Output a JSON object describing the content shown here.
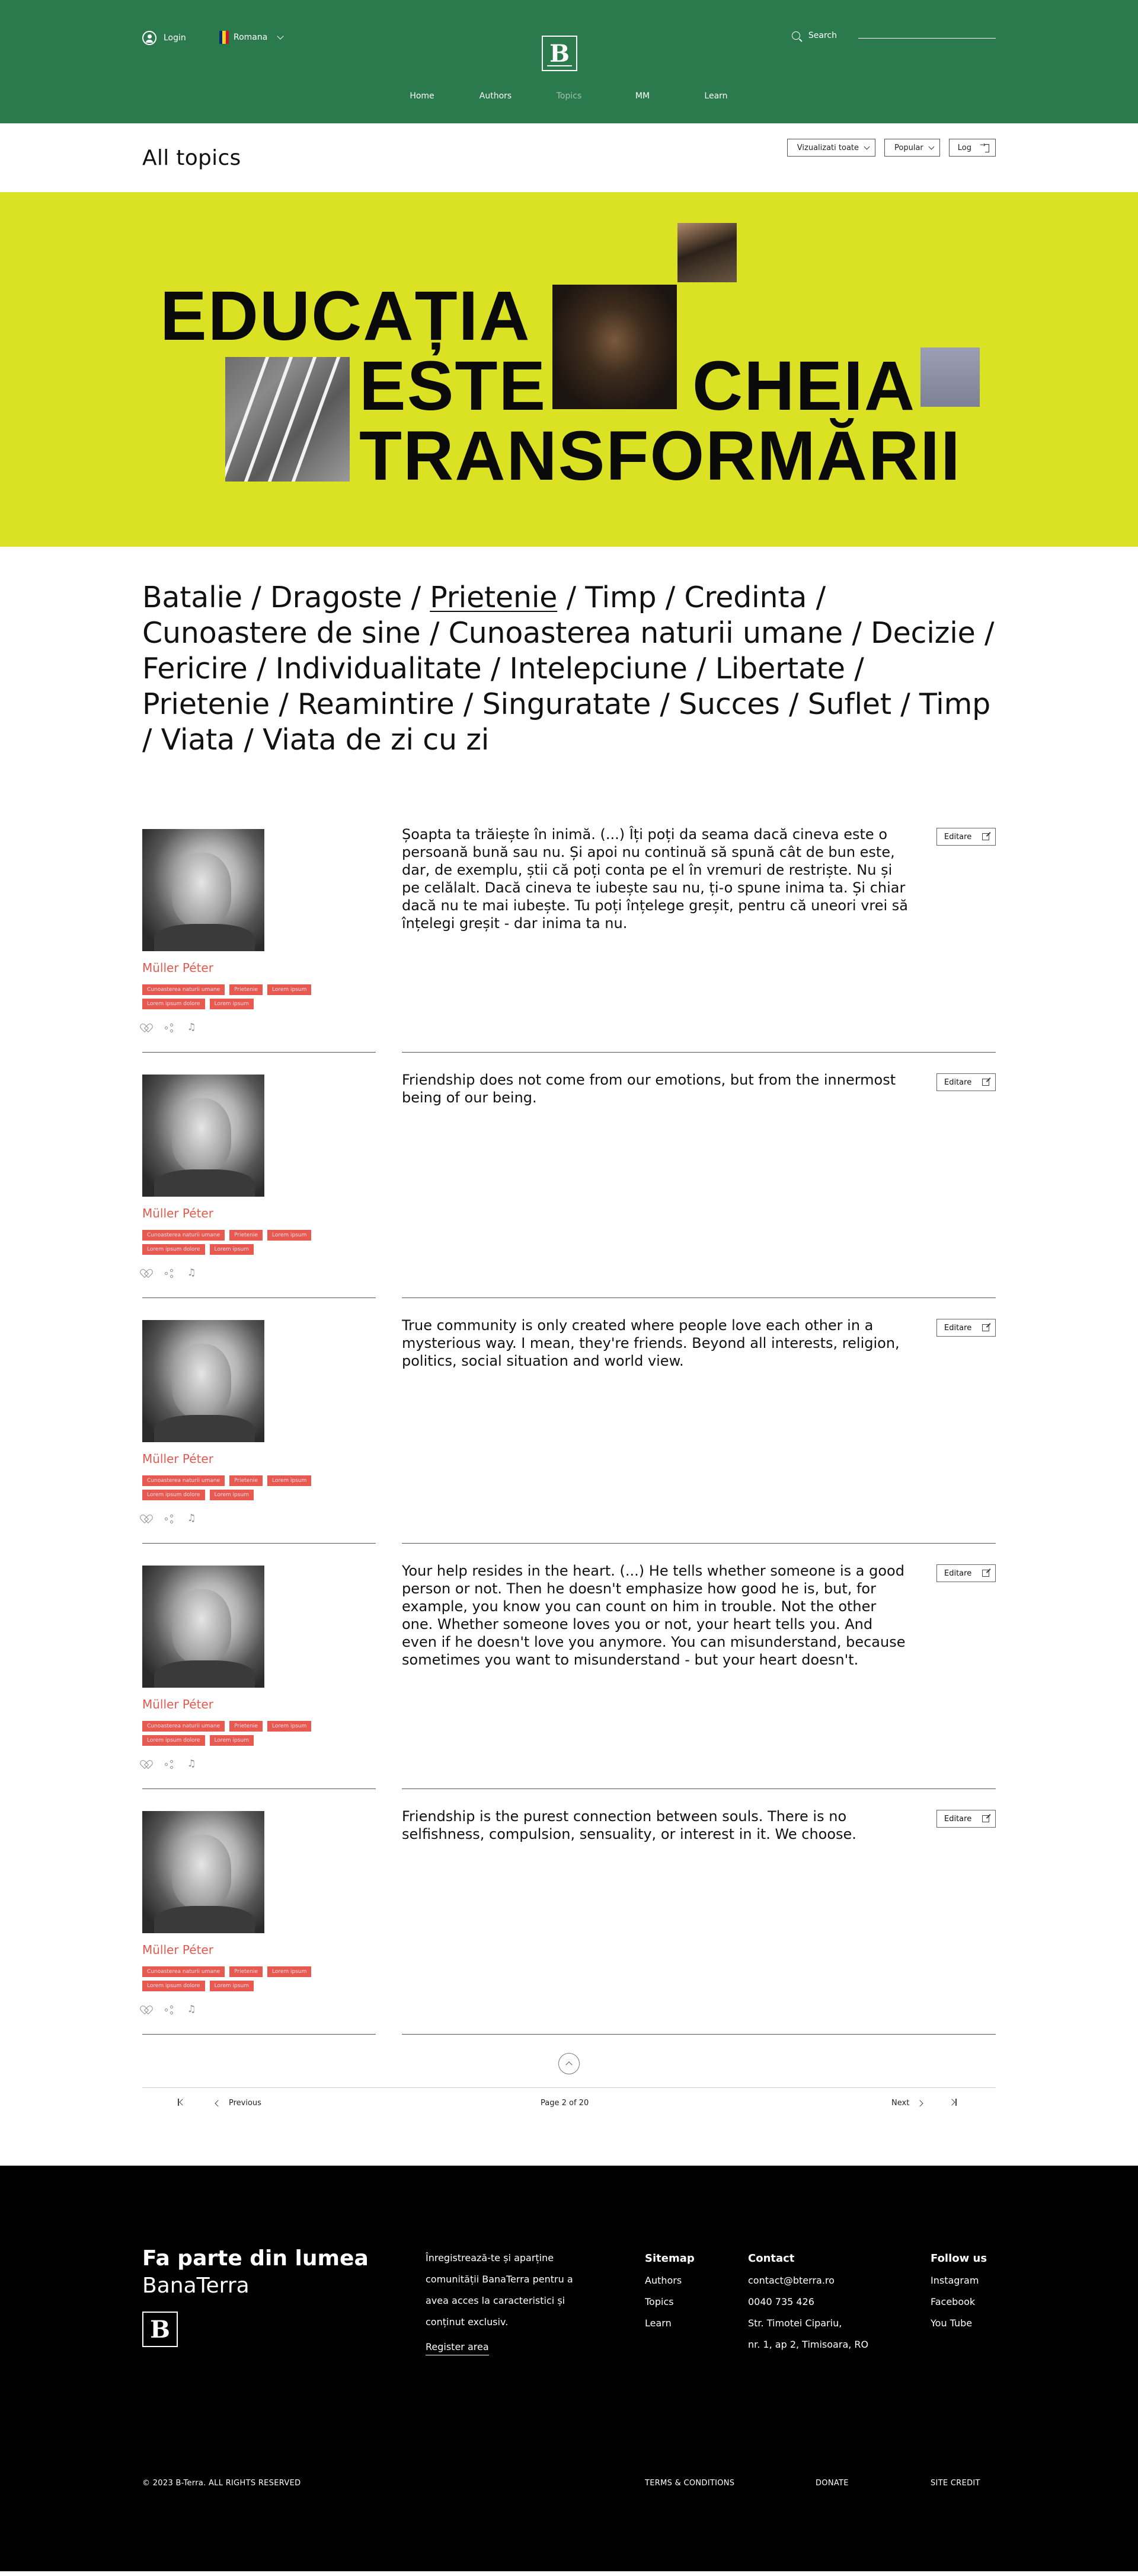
{
  "header": {
    "login_label": "Login",
    "language_label": "Romana",
    "logo_letter": "B",
    "search_label": "Search",
    "nav": [
      "Home",
      "Authors",
      "Topics",
      "MM",
      "Learn"
    ],
    "active_nav": "Topics",
    "flag_colors": [
      "#002b7f",
      "#fcd116",
      "#ce1126"
    ]
  },
  "toolbar": {
    "title": "All topics",
    "view_select": "Vizualizati toate",
    "sort_select": "Popular",
    "log_label": "Log"
  },
  "hero": {
    "line1": "EDUCAȚIA",
    "line2a": "ESTE",
    "line2b": "CHEIA",
    "line3": "TRANSFORMĂRII",
    "background": "#dbe123"
  },
  "topics": {
    "before": "Batalie / Dragoste / ",
    "selected": "Prietenie",
    "after": " / Timp / Credinta / Cunoastere de sine / Cunoasterea naturii umane / Decizie / Fericire / Individualitate / Intelepciune / Libertate / Prietenie / Reamintire / Singuratate / Succes / Suflet /  Timp / Viata / Viata de zi cu zi"
  },
  "quote_common": {
    "author": "Müller Péter",
    "tags": [
      "Cunoasterea naturii umane",
      "Prietenie",
      "Lorem ipsum",
      "Lorem ipsum dolore",
      "Lorem ipsum"
    ],
    "edit_label": "Editare",
    "tag_color": "#e85a4f",
    "author_color": "#e25a4f"
  },
  "quotes": [
    {
      "text": "Șoapta ta trăiește în inimă. (...) Îți poți da seama dacă cineva este o persoană bună sau nu. Și apoi nu continuă să spună cât de bun este, dar, de exemplu, știi că poți conta pe el în vremuri de restriște. Nu și pe celălalt. Dacă cineva te iubește sau nu, ți-o spune inima ta. Și chiar dacă nu te mai iubește. Tu poți înțelege greșit, pentru că uneori vrei să înțelegi greșit - dar inima ta nu."
    },
    {
      "text": "Friendship does not come from our emotions, but from the innermost being of our being."
    },
    {
      "text": "True community is only created where people love each other in a mysterious way. I mean, they're friends. Beyond all interests, religion, politics, social situation and world view."
    },
    {
      "text": "Your help resides in the heart. (...) He tells whether someone is a good person or not. Then he doesn't emphasize how good he is, but, for example, you know you can count on him in trouble. Not the other one. Whether someone loves you or not, your heart tells you. And even if he doesn't love you anymore. You can misunderstand, because sometimes you want to misunderstand - but your heart doesn't."
    },
    {
      "text": "Friendship is the purest connection between souls. There is no selfishness, compulsion, sensuality, or interest in it. We choose."
    }
  ],
  "pagination": {
    "previous": "Previous",
    "page_info": "Page 2 of 20",
    "next": "Next"
  },
  "footer": {
    "title_line1": "Fa parte din lumea",
    "title_line2": "BanaTerra",
    "logo_letter": "B",
    "description": "Înregistrează-te și aparține comunității BanaTerra pentru a avea acces la caracteristici și conținut exclusiv.",
    "register_label": "Register area",
    "sitemap": {
      "heading": "Sitemap",
      "items": [
        "Authors",
        "Topics",
        "Learn"
      ]
    },
    "contact": {
      "heading": "Contact",
      "items": [
        "contact@bterra.ro",
        "0040 735 426",
        "Str. Timotei Cipariu,",
        "nr. 1, ap 2, Timisoara, RO"
      ]
    },
    "follow": {
      "heading": "Follow us",
      "items": [
        "Instagram",
        "Facebook",
        "You Tube"
      ]
    },
    "copyright": "© 2023 B-Terra. ALL RIGHTS RESERVED",
    "terms": "TERMS & CONDITIONS",
    "donate": "DONATE",
    "site_credit": "SITE CREDIT"
  }
}
